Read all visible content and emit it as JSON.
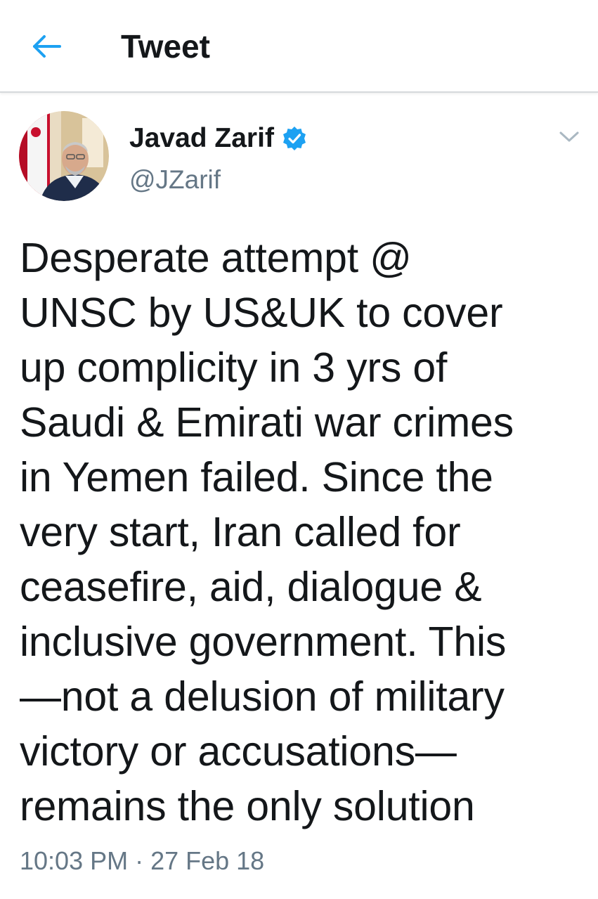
{
  "header": {
    "back_icon": "arrow-left-icon",
    "title": "Tweet"
  },
  "tweet": {
    "author": {
      "display_name": "Javad Zarif",
      "handle": "@JZarif",
      "verified": true,
      "verified_icon": "verified-badge-icon"
    },
    "caret_icon": "chevron-down-icon",
    "text": "Desperate attempt @\nUNSC by US&UK to cover\nup complicity in 3 yrs of\nSaudi & Emirati war crimes\nin Yemen failed. Since the\nvery start, Iran called for\nceasefire, aid, dialogue &\ninclusive government. This\n—not a delusion of military\nvictory or accusations—\nremains the only solution",
    "timestamp": "10:03 PM · 27 Feb 18"
  },
  "colors": {
    "accent": "#1da1f2",
    "text_primary": "#14171a",
    "text_secondary": "#657786",
    "divider": "#d6d9dc"
  }
}
